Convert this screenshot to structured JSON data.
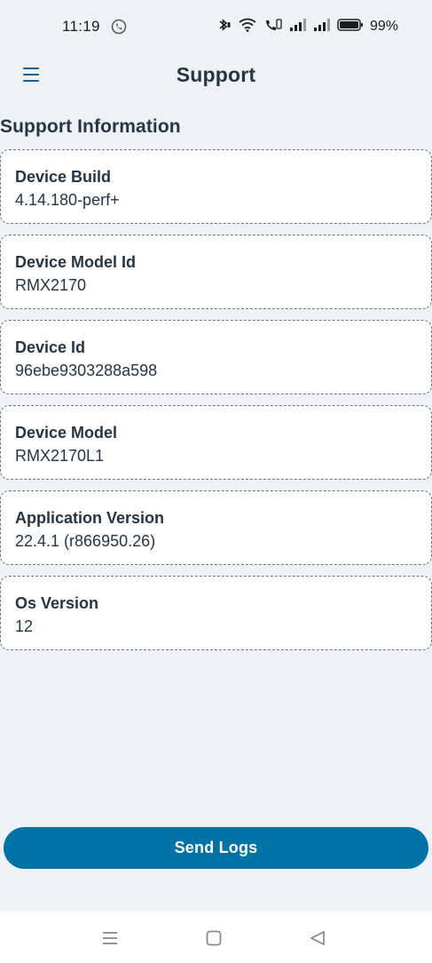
{
  "status_bar": {
    "time": "11:19",
    "battery": "99%"
  },
  "header": {
    "title": "Support"
  },
  "section": {
    "title": "Support Information"
  },
  "info_items": [
    {
      "label": "Device Build",
      "value": "4.14.180-perf+"
    },
    {
      "label": "Device Model Id",
      "value": "RMX2170"
    },
    {
      "label": "Device Id",
      "value": "96ebe9303288a598"
    },
    {
      "label": "Device Model",
      "value": "RMX2170L1"
    },
    {
      "label": "Application Version",
      "value": "22.4.1 (r866950.26)"
    },
    {
      "label": "Os Version",
      "value": "12"
    }
  ],
  "actions": {
    "send_logs": "Send Logs"
  },
  "colors": {
    "accent": "#0073a6",
    "background": "#eef2f6",
    "text": "#263544"
  }
}
